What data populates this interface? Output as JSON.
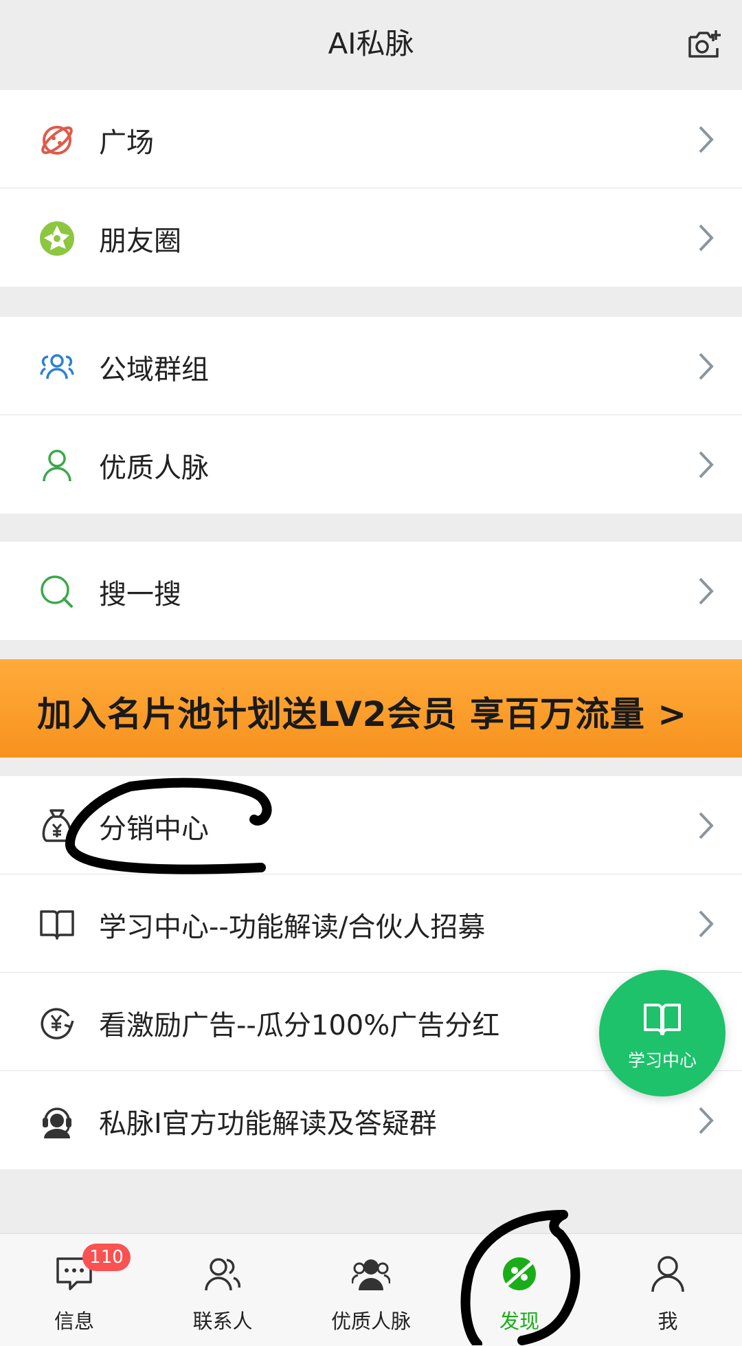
{
  "header": {
    "title": "AI私脉",
    "camera_icon": "camera-plus-icon"
  },
  "groups": [
    {
      "items": [
        {
          "label": "广场",
          "icon": "planet-icon",
          "icon_color": "#e05a4a"
        },
        {
          "label": "朋友圈",
          "icon": "moments-aperture-icon",
          "icon_color": "#8dc63f"
        }
      ]
    },
    {
      "items": [
        {
          "label": "公域群组",
          "icon": "group-users-icon",
          "icon_color": "#2b7fd4"
        },
        {
          "label": "优质人脉",
          "icon": "person-icon",
          "icon_color": "#3aa84a"
        }
      ]
    },
    {
      "items": [
        {
          "label": "搜一搜",
          "icon": "search-icon",
          "icon_color": "#3aa84a"
        }
      ]
    }
  ],
  "banner": {
    "text": "加入名片池计划送LV2会员  享百万流量 >",
    "color": "#f7921e"
  },
  "list2": [
    {
      "label": "分销中心",
      "icon": "money-bag-icon"
    },
    {
      "label": "学习中心--功能解读/合伙人招募",
      "icon": "book-icon"
    },
    {
      "label": "看激励广告--瓜分100%广告分红",
      "icon": "yuan-refresh-icon"
    },
    {
      "label": "私脉I官方功能解读及答疑群",
      "icon": "headset-support-icon"
    }
  ],
  "fab": {
    "label": "学习中心",
    "icon": "book-icon",
    "color": "#1dc26b"
  },
  "tabbar": {
    "tabs": [
      {
        "label": "信息",
        "icon": "chat-icon",
        "badge": "110"
      },
      {
        "label": "联系人",
        "icon": "contacts-icon"
      },
      {
        "label": "优质人脉",
        "icon": "quality-contacts-icon"
      },
      {
        "label": "发现",
        "icon": "discover-planet-icon",
        "active": true
      },
      {
        "label": "我",
        "icon": "me-person-icon"
      }
    ],
    "active_color": "#1aad19"
  }
}
